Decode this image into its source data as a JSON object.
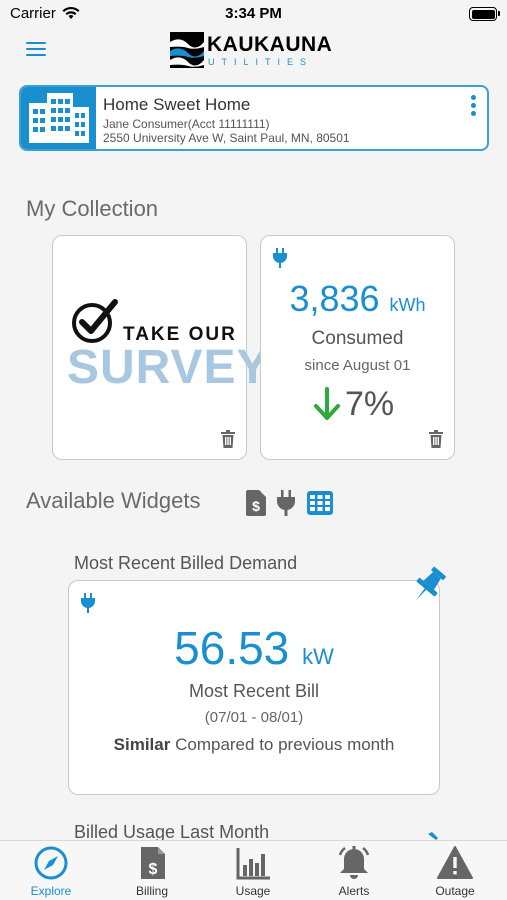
{
  "status_bar": {
    "carrier": "Carrier",
    "time": "3:34 PM"
  },
  "header": {
    "logo_name": "KAUKAUNA",
    "logo_sub": "UTILITIES"
  },
  "account": {
    "title": "Home Sweet Home",
    "holder": "Jane Consumer(Acct 11111111)",
    "address": "2550 University Ave W, Saint Paul, MN, 80501"
  },
  "my_collection": {
    "title": "My Collection",
    "survey": {
      "top_text": "TAKE OUR",
      "big_text": "SURVEY"
    },
    "usage": {
      "value": "3,836",
      "unit": "kWh",
      "label": "Consumed",
      "since": "since August 01",
      "change": "7%",
      "change_direction": "down"
    }
  },
  "available_widgets": {
    "title": "Available Widgets",
    "filters": [
      "billing-icon",
      "plug-icon",
      "grid-icon"
    ],
    "items": [
      {
        "caption": "Most Recent Billed Demand",
        "value": "56.53",
        "unit": "kW",
        "label": "Most Recent Bill",
        "range": "(07/01 - 08/01)",
        "compare_bold": "Similar",
        "compare_text": "Compared to previous month"
      },
      {
        "caption": "Billed Usage Last Month"
      }
    ]
  },
  "tabs": [
    {
      "label": "Explore",
      "icon": "compass-icon",
      "active": true
    },
    {
      "label": "Billing",
      "icon": "bill-icon",
      "active": false
    },
    {
      "label": "Usage",
      "icon": "bar-chart-icon",
      "active": false
    },
    {
      "label": "Alerts",
      "icon": "bell-icon",
      "active": false
    },
    {
      "label": "Outage",
      "icon": "warning-icon",
      "active": false
    }
  ],
  "colors": {
    "accent": "#1a8fd0",
    "down_arrow": "#2eaa3a"
  }
}
